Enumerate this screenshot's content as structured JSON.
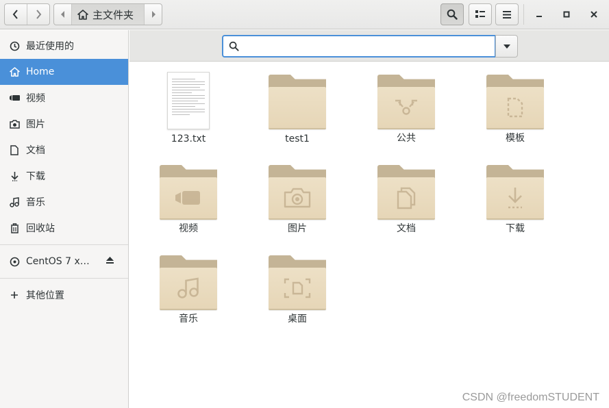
{
  "header": {
    "path_label": "主文件夹",
    "window_controls": [
      "minimize",
      "maximize",
      "close"
    ]
  },
  "sidebar": {
    "items": [
      {
        "label": "最近使用的",
        "icon": "recent-clock-icon",
        "selected": false
      },
      {
        "label": "Home",
        "icon": "home-icon",
        "selected": true
      },
      {
        "label": "视频",
        "icon": "video-camera-icon",
        "selected": false
      },
      {
        "label": "图片",
        "icon": "camera-icon",
        "selected": false
      },
      {
        "label": "文档",
        "icon": "document-icon",
        "selected": false
      },
      {
        "label": "下载",
        "icon": "download-arrow-icon",
        "selected": false
      },
      {
        "label": "音乐",
        "icon": "music-note-icon",
        "selected": false
      },
      {
        "label": "回收站",
        "icon": "trash-icon",
        "selected": false
      }
    ],
    "devices": [
      {
        "label": "CentOS 7 x…",
        "icon": "disc-icon",
        "eject": true
      }
    ],
    "other": {
      "label": "其他位置",
      "icon": "plus-icon"
    }
  },
  "search": {
    "value": "",
    "placeholder": ""
  },
  "files": [
    {
      "name": "123.txt",
      "type": "text-file"
    },
    {
      "name": "test1",
      "type": "folder",
      "emblem": "none"
    },
    {
      "name": "公共",
      "type": "folder",
      "emblem": "share-icon"
    },
    {
      "name": "模板",
      "type": "folder",
      "emblem": "template-icon"
    },
    {
      "name": "视频",
      "type": "folder",
      "emblem": "video-camera-icon"
    },
    {
      "name": "图片",
      "type": "folder",
      "emblem": "camera-icon"
    },
    {
      "name": "文档",
      "type": "folder",
      "emblem": "document-icon"
    },
    {
      "name": "下载",
      "type": "folder",
      "emblem": "download-arrow-icon"
    },
    {
      "name": "音乐",
      "type": "folder",
      "emblem": "music-note-icon"
    },
    {
      "name": "桌面",
      "type": "folder",
      "emblem": "desktop-icon"
    }
  ],
  "watermark": "CSDN @freedomSTUDENT",
  "colors": {
    "selection": "#4a90d9",
    "folder_tab": "#c4b496",
    "folder_body": "#ede0c6",
    "sidebar_bg": "#f6f5f4"
  }
}
